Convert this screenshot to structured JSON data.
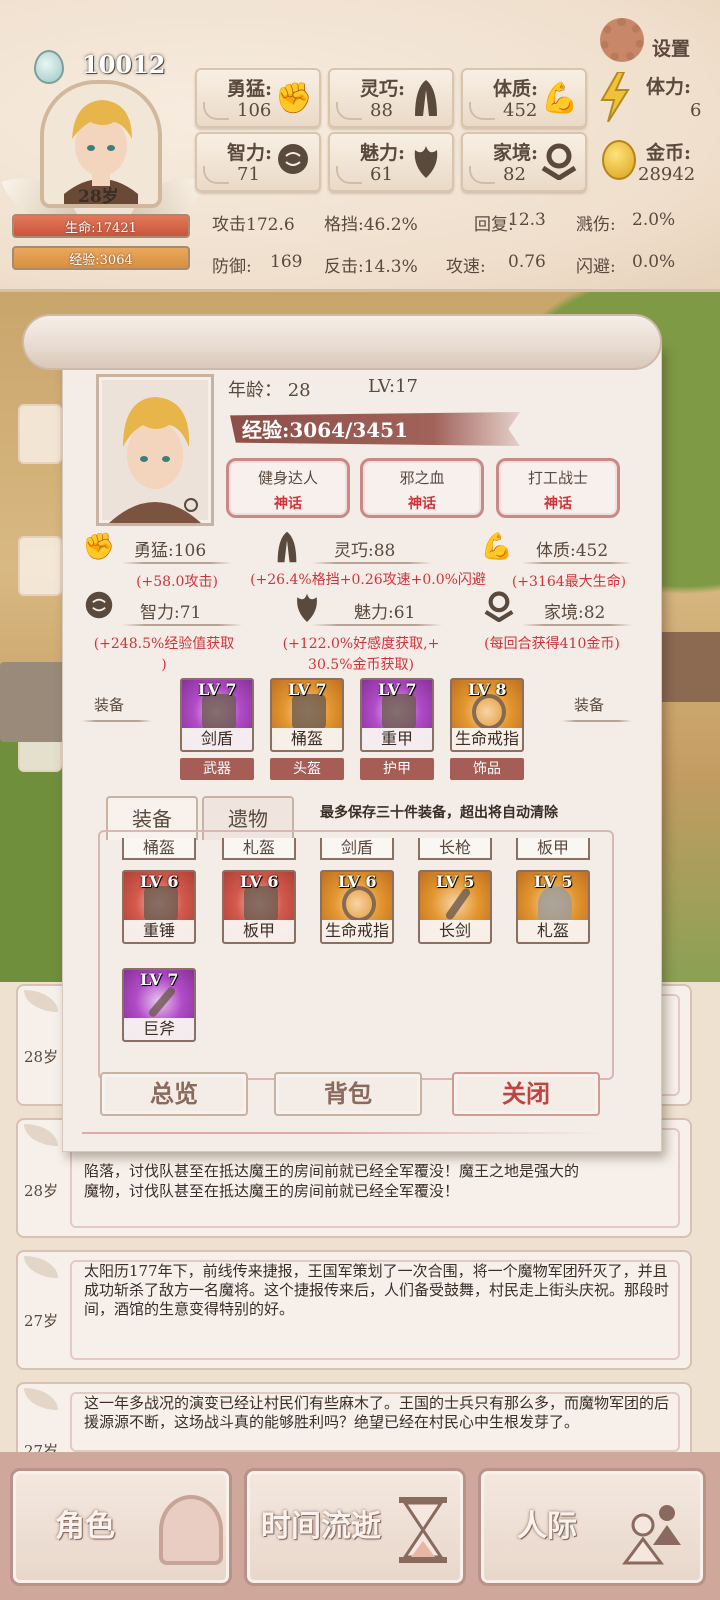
{
  "header": {
    "gems": "10012",
    "age": "28岁",
    "hp_label": "生命:17421",
    "exp_label": "经验:3064",
    "settings_label": "设置"
  },
  "stats": [
    {
      "label": "勇猛:",
      "value": "106",
      "icon": "fist-icon"
    },
    {
      "label": "灵巧:",
      "value": "88",
      "icon": "cloak-icon"
    },
    {
      "label": "体质:",
      "value": "452",
      "icon": "arm-icon"
    },
    {
      "label": "智力:",
      "value": "71",
      "icon": "brain-icon"
    },
    {
      "label": "魅力:",
      "value": "61",
      "icon": "flower-icon"
    },
    {
      "label": "家境:",
      "value": "82",
      "icon": "house-icon"
    }
  ],
  "resources": {
    "stamina_label": "体力:",
    "stamina_value": "6",
    "gold_label": "金币:",
    "gold_value": "28942"
  },
  "combat": [
    "攻击172.6",
    "格挡:46.2%",
    "回复:",
    "12.3",
    "溅伤:",
    "2.0%",
    "防御:",
    "169",
    "反击:14.3%",
    "攻速:",
    "0.76",
    "闪避:",
    "0.0%"
  ],
  "panel": {
    "age_text": "年龄： 28",
    "level_text": "LV:17",
    "exp_text": "经验:3064/3451",
    "tags": [
      {
        "name": "健身达人",
        "rarity": "神话"
      },
      {
        "name": "邪之血",
        "rarity": "神话"
      },
      {
        "name": "打工战士",
        "rarity": "神话"
      }
    ],
    "attrs": [
      {
        "label": "勇猛:106",
        "effect": "(+58.0攻击)"
      },
      {
        "label": "灵巧:88",
        "effect": "(+26.4%格挡+0.26攻速+0.0%闪避"
      },
      {
        "label": "体质:452",
        "effect": "(+3164最大生命)"
      },
      {
        "label": "智力:71",
        "effect": "(+248.5%经验值获取\n)"
      },
      {
        "label": "魅力:61",
        "effect": "(+122.0%好感度获取,+\n30.5%金币获取)"
      },
      {
        "label": "家境:82",
        "effect": "(每回合获得410金币)"
      }
    ],
    "equip_label_left": "装备",
    "equip_label_right": "装备",
    "equipped": [
      {
        "level": "LV 7",
        "name": "剑盾",
        "slot": "武器",
        "bg": "purple"
      },
      {
        "level": "LV 7",
        "name": "桶盔",
        "slot": "头盔",
        "bg": "orange"
      },
      {
        "level": "LV 7",
        "name": "重甲",
        "slot": "护甲",
        "bg": "purple"
      },
      {
        "level": "LV 8",
        "name": "生命戒指",
        "slot": "饰品",
        "bg": "orange"
      }
    ],
    "tabs": [
      "装备",
      "遗物"
    ],
    "notice": "最多保存三十件装备，超出将自动清除",
    "inventory_partial": [
      "桶盔",
      "札盔",
      "剑盾",
      "长枪",
      "板甲"
    ],
    "inventory": [
      {
        "level": "LV 6",
        "name": "重锤",
        "bg": "red"
      },
      {
        "level": "LV 6",
        "name": "板甲",
        "bg": "red"
      },
      {
        "level": "LV 6",
        "name": "生命戒指",
        "bg": "orange"
      },
      {
        "level": "LV 5",
        "name": "长剑",
        "bg": "orange"
      },
      {
        "level": "LV 5",
        "name": "札盔",
        "bg": "orange"
      },
      {
        "level": "LV 7",
        "name": "巨斧",
        "bg": "purple"
      }
    ],
    "buttons": [
      "总览",
      "背包",
      "关闭"
    ]
  },
  "log": [
    {
      "age": "28岁",
      "text": ""
    },
    {
      "age": "28岁",
      "text": "魔物，讨伐队甚至在抵达魔王的房间前就已经全军覆没！"
    },
    {
      "age": "27岁",
      "text": "太阳历177年下，前线传来捷报，王国军策划了一次合围，将一个魔物军团歼灭了，并且成功斩杀了敌方一名魔将。这个捷报传来后，人们备受鼓舞，村民走上街头庆祝。那段时间，酒馆的生意变得特别的好。"
    },
    {
      "age": "27岁",
      "text": "这一年多战况的演变已经让村民们有些麻木了。王国的士兵只有那么多，而魔物军团的后援源源不断，这场战斗真的能够胜利吗？绝望已经在村民心中生根发芽了。"
    }
  ],
  "log_partial_top": "陷落，讨伐队甚至在抵达魔王的房间前就已经全军覆没！魔王之地是强大的",
  "nav": [
    "角色",
    "时间流逝",
    "人际"
  ]
}
